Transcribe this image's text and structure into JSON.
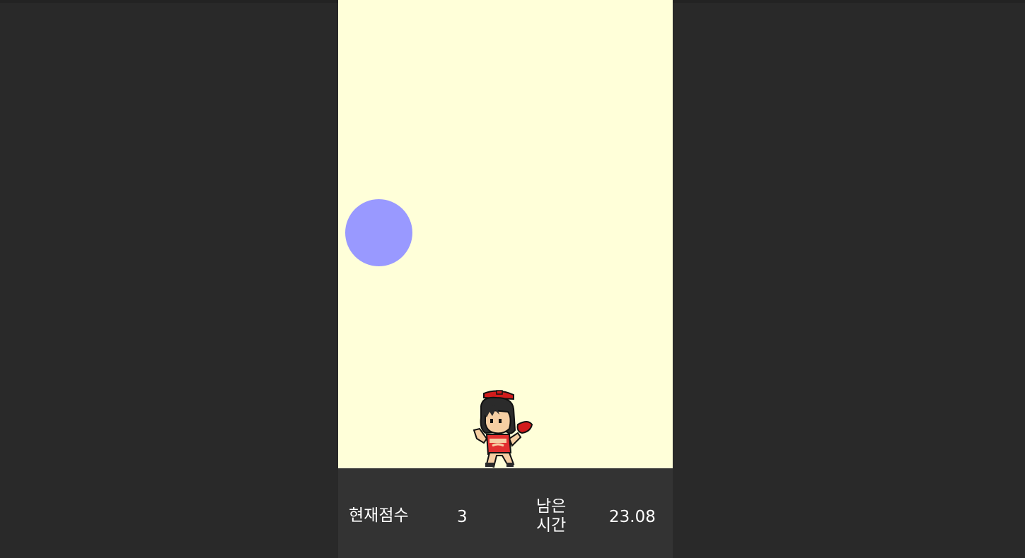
{
  "colors": {
    "outer_background": "#292929",
    "play_area": "#ffffd9",
    "ball": "#9999ff",
    "hud_background": "#333333",
    "hud_text": "#ffffff"
  },
  "game": {
    "ball": {
      "shape": "circle",
      "color": "#9999ff"
    },
    "player": {
      "sprite": "pixel-art-girl-red-outfit-running"
    }
  },
  "hud": {
    "score_label": "현재점수",
    "score_value": "3",
    "time_label_line1": "남은",
    "time_label_line2": "시간",
    "time_value": "23.08"
  }
}
